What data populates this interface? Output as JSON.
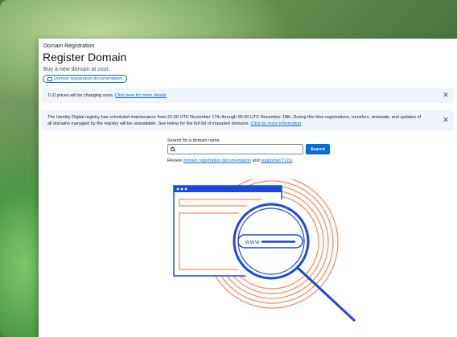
{
  "breadcrumb": "Domain Registration",
  "page_title": "Register Domain",
  "subtitle": "Buy a new domain at cost.",
  "doc_button": "Domain registration documentation",
  "alerts": [
    {
      "text": "TLD prices will be changing soon.",
      "link": "Click here for more details"
    },
    {
      "text": "The Identity Digital registry has scheduled maintenance from 22:00 UTC November 17th through 00:30 UTC November 18th. During this time registrations, transfers, renewals, and updates of all domains managed by the registry will be unavailable. See below for the full list of impacted domains.",
      "link": "Click for more information"
    }
  ],
  "close_glyph": "✕",
  "search": {
    "label": "Search for a domain name",
    "value": "",
    "placeholder": "",
    "button": "Search"
  },
  "review": {
    "prefix": "Review",
    "link1": "domain registration documentation",
    "middle": "and",
    "link2": "supported TLDs",
    "suffix": "."
  },
  "illustration": {
    "url_text": "www"
  },
  "colors": {
    "accent": "#006ce0",
    "illustration_blue": "#1a49e0",
    "illustration_orange": "#f28a5a",
    "alert_bg": "#f0f5fd"
  }
}
